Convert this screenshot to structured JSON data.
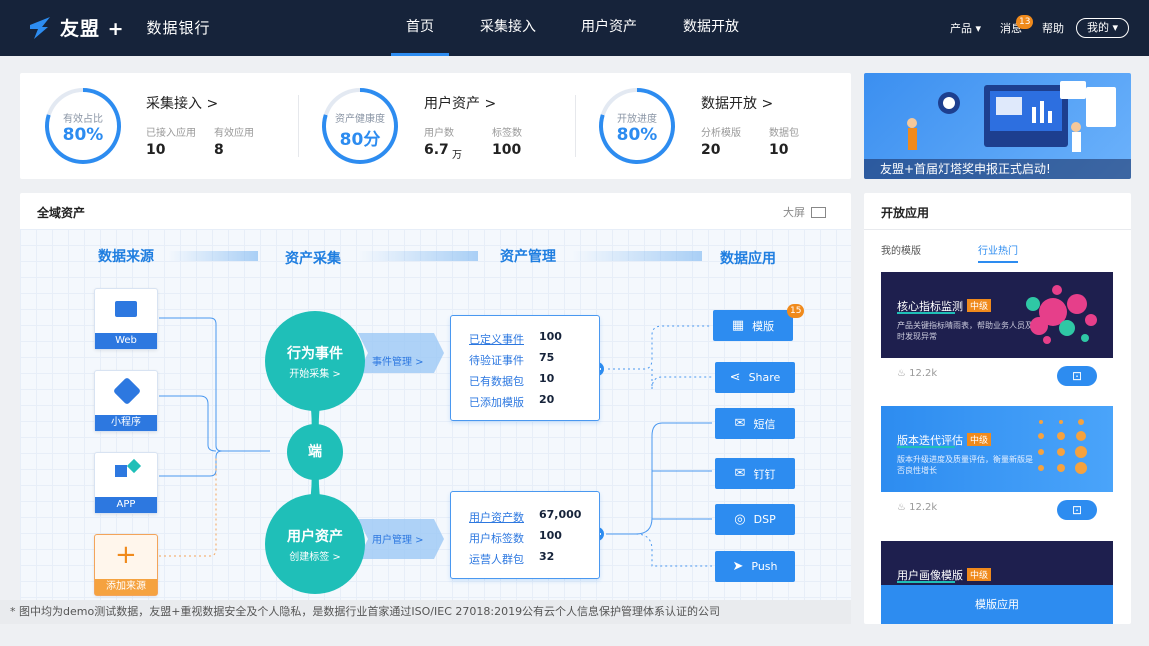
{
  "brand": {
    "logo_text": "友盟 +",
    "sub_title": "数据银行"
  },
  "nav": {
    "items": [
      "首页",
      "采集接入",
      "用户资产",
      "数据开放"
    ],
    "active": 0
  },
  "topright": {
    "product": "产品 ▾",
    "messages": "消息",
    "message_count": "13",
    "help": "帮助",
    "mine": "我的 ▾"
  },
  "stats": [
    {
      "ring_label": "有效占比",
      "ring_value": "80%",
      "progress": 0.8,
      "title": "采集接入 >",
      "k1": "已接入应用",
      "v1": "10",
      "v1_unit": "",
      "k2": "有效应用",
      "v2": "8"
    },
    {
      "ring_label": "资产健康度",
      "ring_value": "80分",
      "progress": 0.8,
      "title": "用户资产 >",
      "k1": "用户数",
      "v1": "6.7",
      "v1_unit": "万",
      "k2": "标签数",
      "v2": "100"
    },
    {
      "ring_label": "开放进度",
      "ring_value": "80%",
      "progress": 0.8,
      "title": "数据开放 >",
      "k1": "分析模版",
      "v1": "20",
      "v1_unit": "",
      "k2": "数据包",
      "v2": "10"
    }
  ],
  "banner": {
    "caption": "友盟+首届灯塔奖申报正式启动!"
  },
  "assets": {
    "title": "全域资产",
    "fullscreen": "大屏",
    "steps": [
      "数据来源",
      "资产采集",
      "资产管理",
      "数据应用"
    ],
    "sources": [
      "Web",
      "小程序",
      "APP",
      "添加来源"
    ],
    "behavior": {
      "title": "行为事件",
      "sub": "开始采集 >",
      "link": "事件管理 >"
    },
    "terminal": "端",
    "user_asset": {
      "title": "用户资产",
      "sub": "创建标签 >",
      "link": "用户管理 >"
    },
    "event_box": [
      [
        "已定义事件",
        "100"
      ],
      [
        "待验证事件",
        "75"
      ],
      [
        "已有数据包",
        "10"
      ],
      [
        "已添加模版",
        "20"
      ]
    ],
    "user_box": [
      [
        "用户资产数",
        "67,000"
      ],
      [
        "用户标签数",
        "100"
      ],
      [
        "运营人群包",
        "32"
      ]
    ],
    "apps": [
      "模版",
      "Share",
      "短信",
      "钉钉",
      "DSP",
      "Push"
    ],
    "app_badge": "15",
    "disclaimer": "* 图中均为demo测试数据，友盟+重视数据安全及个人隐私，是数据行业首家通过ISO/IEC 27018:2019公有云个人信息保护管理体系认证的公司"
  },
  "open_apps": {
    "title": "开放应用",
    "tabs": [
      "我的模版",
      "行业热门"
    ],
    "active_tab": 1,
    "cards": [
      {
        "title": "核心指标监测",
        "tag": "中级",
        "desc": "产品关键指标晴雨表，帮助业务人员及时发现异常",
        "likes": "12.2k"
      },
      {
        "title": "版本迭代评估",
        "tag": "中级",
        "desc": "版本升级进度及质量评估，衡量新版是否良性增长",
        "likes": "12.2k"
      },
      {
        "title": "用户画像模版",
        "tag": "中级",
        "button": "模版应用"
      }
    ]
  },
  "colors": {
    "nav_bg": "#16233a",
    "accent": "#2d8cf0",
    "teal": "#1fbfb8",
    "orange": "#f08a1c"
  }
}
